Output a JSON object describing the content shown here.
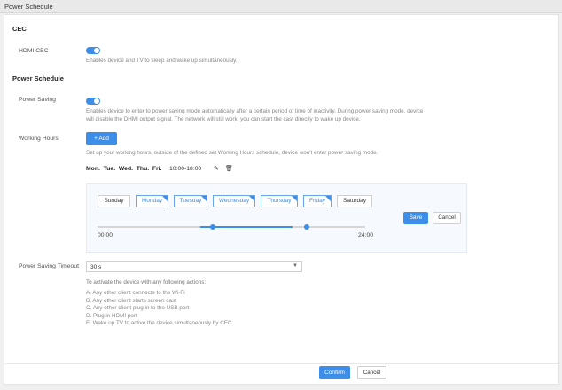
{
  "window": {
    "title": "Power Schedule"
  },
  "cec": {
    "section_title": "CEC",
    "hdmi_label": "HDMI CEC",
    "hdmi_desc": "Enables device and TV to sleep and wake up simultaneously."
  },
  "power_schedule": {
    "section_title": "Power Schedule",
    "power_saving_label": "Power Saving",
    "power_saving_desc": "Enables device to enter to power saving mode automatically after a certain period of time of inactivity. During power saving mode, device will disable the DHMI output signal. The network will still work, you can start the cast directly to wake up device.",
    "working_hours_label": "Working Hours",
    "add_label": "Add",
    "working_hours_desc": "Set up your working hours, outside of the defined set Working Hours schedule, device won't enter power saving mode.",
    "schedule_days": "Mon.  Tue.  Wed.  Thu.  Fri.",
    "schedule_time": "10:00-18:00"
  },
  "editor": {
    "days": [
      {
        "label": "Sunday",
        "selected": false
      },
      {
        "label": "Monday",
        "selected": true
      },
      {
        "label": "Tuesday",
        "selected": true
      },
      {
        "label": "Wednesday",
        "selected": true
      },
      {
        "label": "Thursday",
        "selected": true
      },
      {
        "label": "Friday",
        "selected": true
      },
      {
        "label": "Saturday",
        "selected": false
      }
    ],
    "start_label": "00:00",
    "end_label": "24:00",
    "save_label": "Save",
    "cancel_label": "Cancel"
  },
  "timeout": {
    "label": "Power Saving Timeout",
    "value": "30 s",
    "intro": "To activate the device with any following actions:",
    "actions": [
      "A. Any other client connects to the Wi-Fi",
      "B. Any other client starts screen cast",
      "C. Any other client plug in to the USB port",
      "D. Plug in HDMI port",
      "E. Wake up TV to active the device simultaneously by CEC"
    ]
  },
  "footer": {
    "confirm_label": "Confirm",
    "cancel_label": "Cancel"
  },
  "colors": {
    "accent": "#3d8ee8"
  }
}
